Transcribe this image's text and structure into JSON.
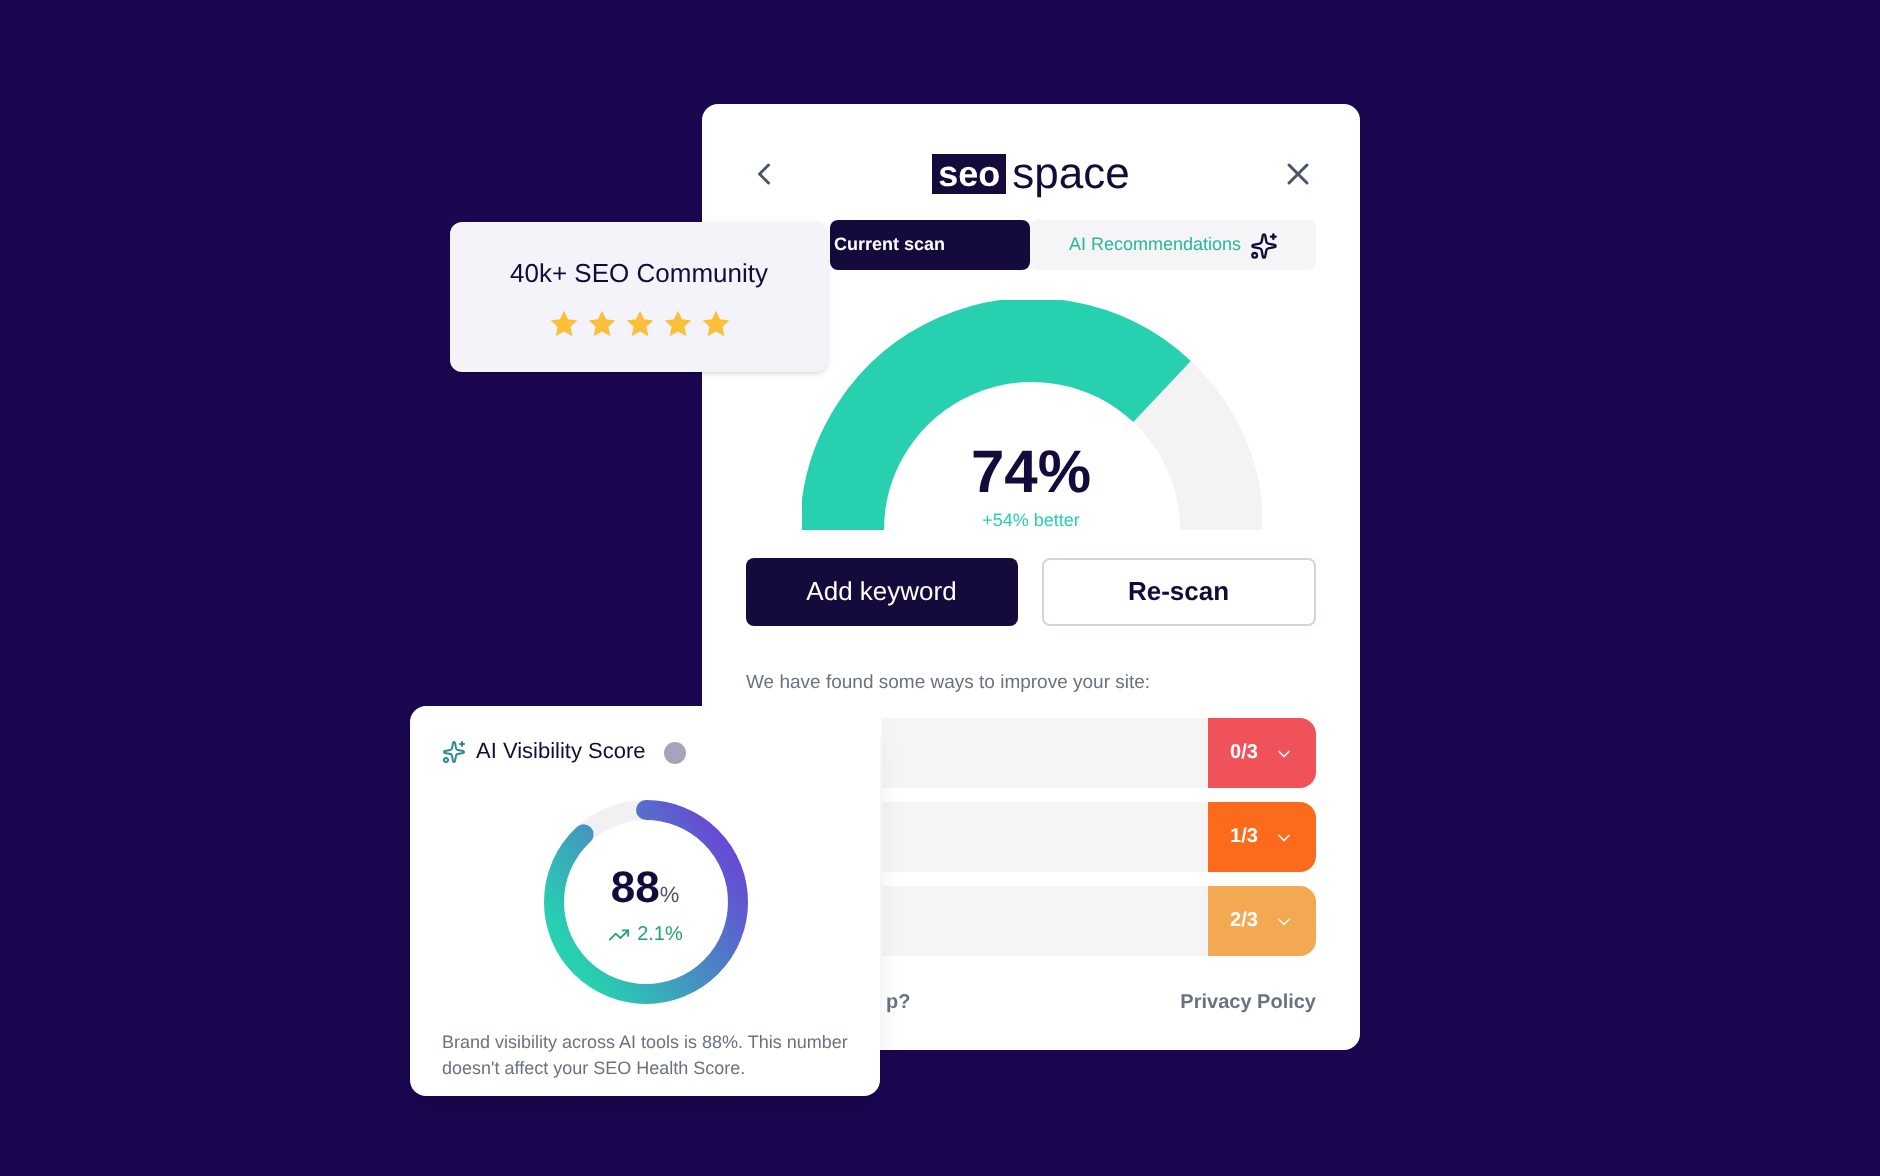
{
  "logo": {
    "mark": "seo",
    "name": "space"
  },
  "tabs": [
    {
      "label": "Current scan",
      "selected": true
    },
    {
      "label": "AI Recommendations",
      "selected": false
    }
  ],
  "gauge": {
    "value": "74%",
    "change": "+54% better"
  },
  "buttons": [
    {
      "label": "Add keyword",
      "kind": "primary"
    },
    {
      "label": "Re-scan",
      "kind": "secondary"
    }
  ],
  "intro": "We have found some ways to improve your site:",
  "issues": [
    {
      "count": "0/3",
      "color": "#f0525a"
    },
    {
      "count": "1/3",
      "color": "#fc6a1c"
    },
    {
      "count": "2/3",
      "color": "#f3a951"
    }
  ],
  "footer": {
    "help": "p?",
    "privacy": "Privacy Policy"
  },
  "community": {
    "title": "40k+ SEO Community",
    "stars": 5
  },
  "visibility": {
    "title": "AI Visibility Score",
    "value": "88",
    "unit": "%",
    "change": "2.1%",
    "level": 0.88,
    "description": "Brand visibility across AI tools is 88%. This number doesn't affect your SEO Health Score."
  }
}
